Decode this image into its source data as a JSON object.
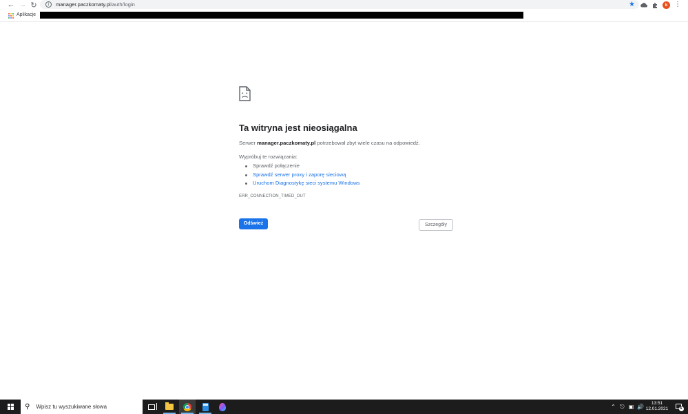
{
  "browser": {
    "url_host": "manager.paczkomaty.pl",
    "url_path": "/auth/login",
    "bookmarks": {
      "apps_label": "Aplikacje"
    },
    "profile_initial": "k"
  },
  "error_page": {
    "title": "Ta witryna jest nieosiągalna",
    "message_prefix": "Serwer ",
    "message_host": "manager.paczkomaty.pl",
    "message_suffix": " potrzebował zbyt wiele czasu na odpowiedź.",
    "suggestions_heading": "Wypróbuj te rozwiązania:",
    "suggestions": [
      {
        "label": "Sprawdź połączenie"
      },
      {
        "label": "Sprawdź serwer proxy i zaporę sieciową"
      },
      {
        "label": "Uruchom Diagnostykę sieci systemu Windows"
      }
    ],
    "error_code": "ERR_CONNECTION_TIMED_OUT",
    "reload_label": "Odśwież",
    "details_label": "Szczegóły"
  },
  "taskbar": {
    "search_placeholder": "Wpisz tu wyszukiwane słowa",
    "time": "13:51",
    "date": "12.01.2021",
    "notification_count": "6"
  },
  "colors": {
    "link": "#1a73e8",
    "primary_button": "#1a73e8",
    "taskbar": "#1c1c1c",
    "avatar": "#e8501e"
  }
}
